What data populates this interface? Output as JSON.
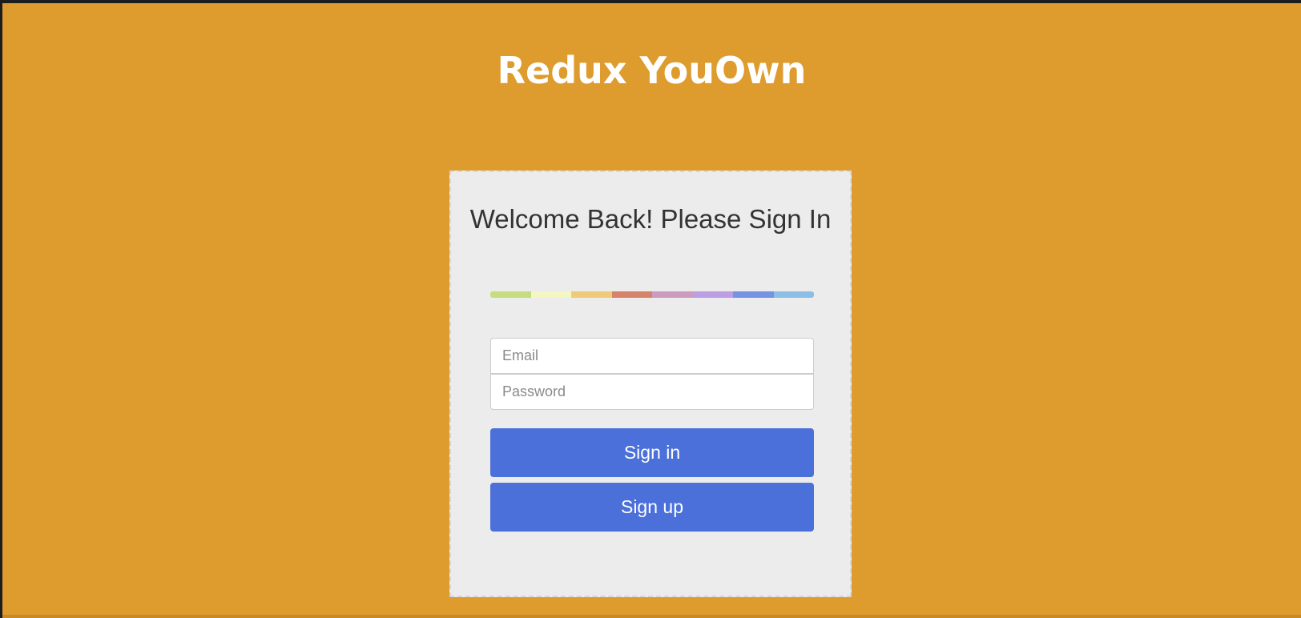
{
  "app": {
    "title": "Redux YouOwn"
  },
  "login": {
    "heading": "Welcome Back! Please Sign In",
    "email_placeholder": "Email",
    "password_placeholder": "Password",
    "signin_label": "Sign in",
    "signup_label": "Sign up"
  },
  "colors": {
    "background": "#de9b2e",
    "card": "#ececec",
    "button": "#4b70d9",
    "rainbow": [
      "#c5dd7e",
      "#f4f7c2",
      "#efcb79",
      "#d7826b",
      "#cb9cbe",
      "#bc9ee3",
      "#7592e3",
      "#8dbee5"
    ]
  }
}
